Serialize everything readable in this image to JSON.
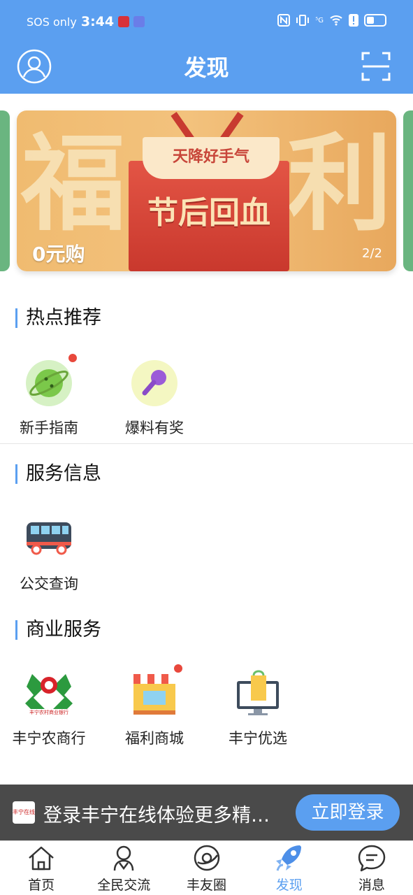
{
  "status_bar": {
    "carrier": "SOS only",
    "time": "3:44",
    "network": "⁵G"
  },
  "header": {
    "title": "发现"
  },
  "banner": {
    "left_char": "福",
    "right_char": "利",
    "card_text": "天降好手气",
    "main_text": "节后回血",
    "caption": "0元购",
    "index": "2/2"
  },
  "sections": [
    {
      "title": "热点推荐",
      "items": [
        {
          "label": "新手指南",
          "icon": "planet-icon",
          "badge": true
        },
        {
          "label": "爆料有奖",
          "icon": "microphone-icon",
          "badge": false
        }
      ]
    },
    {
      "title": "服务信息",
      "items": [
        {
          "label": "公交查询",
          "icon": "bus-icon",
          "badge": false
        }
      ]
    },
    {
      "title": "商业服务",
      "items": [
        {
          "label": "丰宁农商行",
          "icon": "bank-logo-icon",
          "badge": false
        },
        {
          "label": "福利商城",
          "icon": "shop-icon",
          "badge": true
        },
        {
          "label": "丰宁优选",
          "icon": "shopping-bag-monitor-icon",
          "badge": false
        }
      ]
    }
  ],
  "bank_logo_text": "丰宁农村商业银行",
  "login_prompt": {
    "text": "登录丰宁在线体验更多精彩内容",
    "button": "立即登录",
    "logo_text": "丰宁在线"
  },
  "bottom_nav": [
    {
      "label": "首页",
      "icon": "home-icon",
      "active": false
    },
    {
      "label": "全民交流",
      "icon": "community-icon",
      "active": false
    },
    {
      "label": "丰友圈",
      "icon": "circle-icon",
      "active": false
    },
    {
      "label": "发现",
      "icon": "rocket-icon",
      "active": true
    },
    {
      "label": "消息",
      "icon": "message-icon",
      "active": false
    }
  ],
  "colors": {
    "primary": "#5b9ff0",
    "badge": "#e8483c",
    "login_bar": "#4a4a4a"
  }
}
